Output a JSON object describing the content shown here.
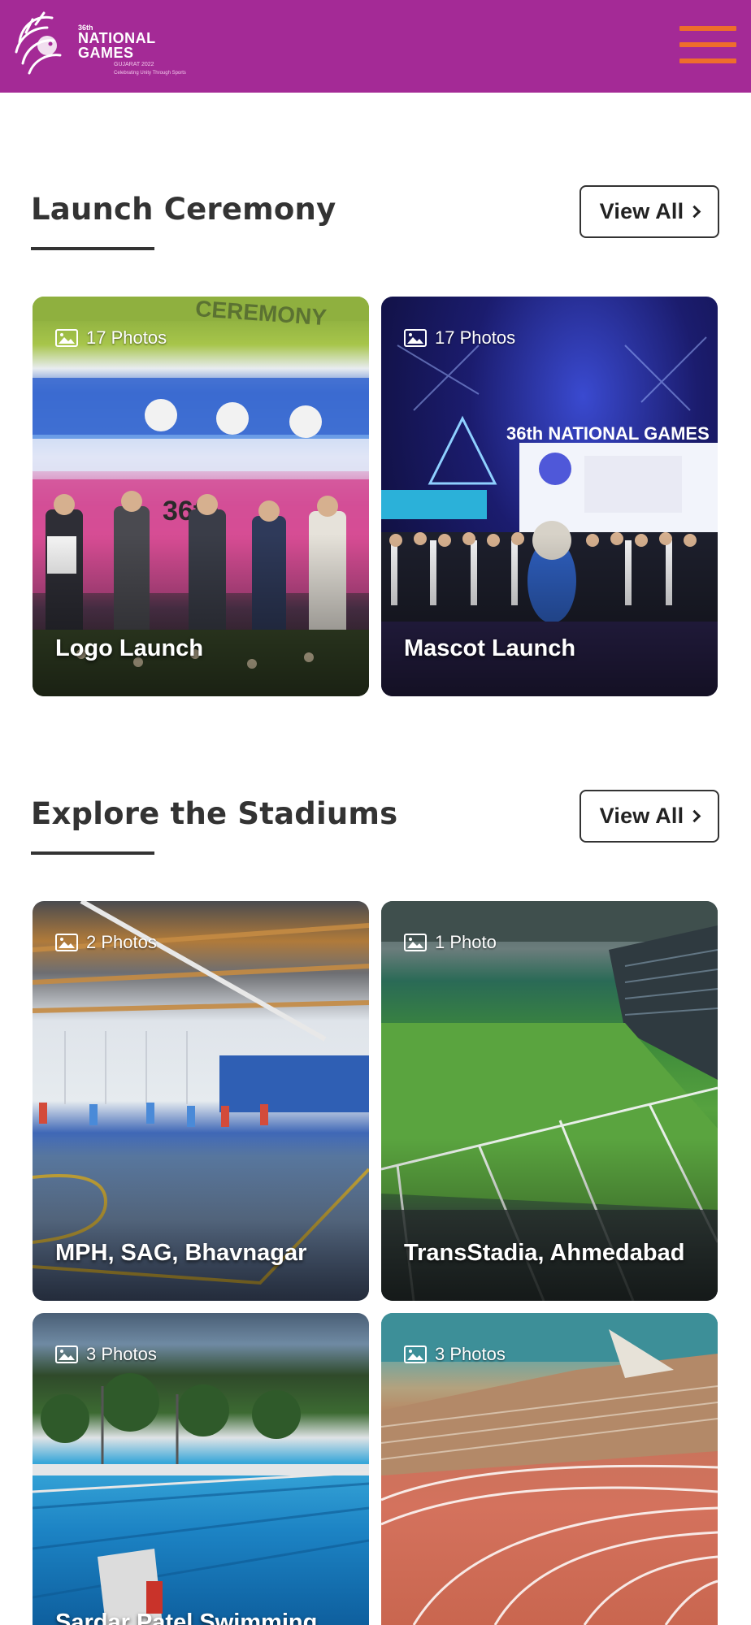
{
  "header": {
    "logo_small": "36th",
    "logo_title": "NATIONAL GAMES",
    "logo_sub": "GUJARAT 2022",
    "logo_tag": "Celebrating Unity Through Sports",
    "menu_icon": "hamburger-menu-icon",
    "bg_color": "#a42a96",
    "menu_color": "#ee6d2c"
  },
  "launch_ceremony": {
    "title": "Launch Ceremony",
    "view_all": "View All",
    "cards": [
      {
        "count": "17 Photos",
        "caption": "Logo Launch"
      },
      {
        "count": "17 Photos",
        "caption": "Mascot Launch"
      }
    ]
  },
  "stadiums": {
    "title": "Explore the Stadiums",
    "view_all": "View All",
    "cards": [
      {
        "count": "2 Photos",
        "caption": "MPH, SAG, Bhavnagar"
      },
      {
        "count": "1 Photo",
        "caption": "TransStadia, Ahmedabad"
      },
      {
        "count": "3 Photos",
        "caption": "Sardar Patel Swimming"
      },
      {
        "count": "3 Photos",
        "caption": ""
      }
    ]
  },
  "mascot_banner": "36th NATIONAL GAMES"
}
